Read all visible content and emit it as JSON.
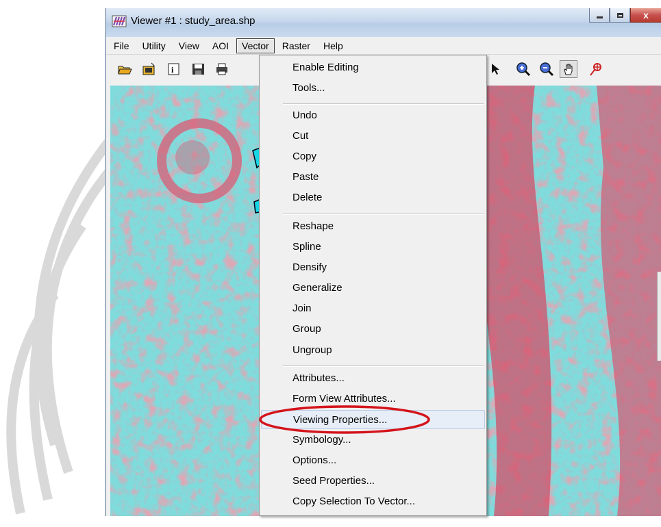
{
  "window": {
    "title": "Viewer #1 : study_area.shp",
    "controls": {
      "close_glyph": "x"
    }
  },
  "menubar": {
    "items": [
      {
        "label": "File"
      },
      {
        "label": "Utility"
      },
      {
        "label": "View"
      },
      {
        "label": "AOI"
      },
      {
        "label": "Vector"
      },
      {
        "label": "Raster"
      },
      {
        "label": "Help"
      }
    ],
    "active": "Vector"
  },
  "toolbar": {
    "icons": [
      "open-folder-icon",
      "open-layer-icon",
      "info-icon",
      "save-icon",
      "print-icon",
      "select-arrow-icon",
      "zoom-in-icon",
      "zoom-out-icon",
      "pan-hand-icon",
      "inquire-cursor-icon"
    ]
  },
  "vector_menu": {
    "items": [
      {
        "label": "Enable Editing"
      },
      {
        "label": "Tools..."
      },
      {
        "label": "Undo"
      },
      {
        "label": "Cut"
      },
      {
        "label": "Copy"
      },
      {
        "label": "Paste"
      },
      {
        "label": "Delete"
      },
      {
        "label": "Reshape"
      },
      {
        "label": "Spline"
      },
      {
        "label": "Densify"
      },
      {
        "label": "Generalize"
      },
      {
        "label": "Join"
      },
      {
        "label": "Group"
      },
      {
        "label": "Ungroup"
      },
      {
        "label": "Attributes..."
      },
      {
        "label": "Form View Attributes..."
      },
      {
        "label": "Viewing Properties..."
      },
      {
        "label": "Symbology..."
      },
      {
        "label": "Options..."
      },
      {
        "label": "Seed Properties..."
      },
      {
        "label": "Copy Selection To Vector..."
      }
    ],
    "highlighted": "Viewing Properties..."
  },
  "colors": {
    "highlight_ring": "#d4141c",
    "imagery_vegetation": "#d8566e",
    "imagery_soil": "#7fe0e0"
  }
}
